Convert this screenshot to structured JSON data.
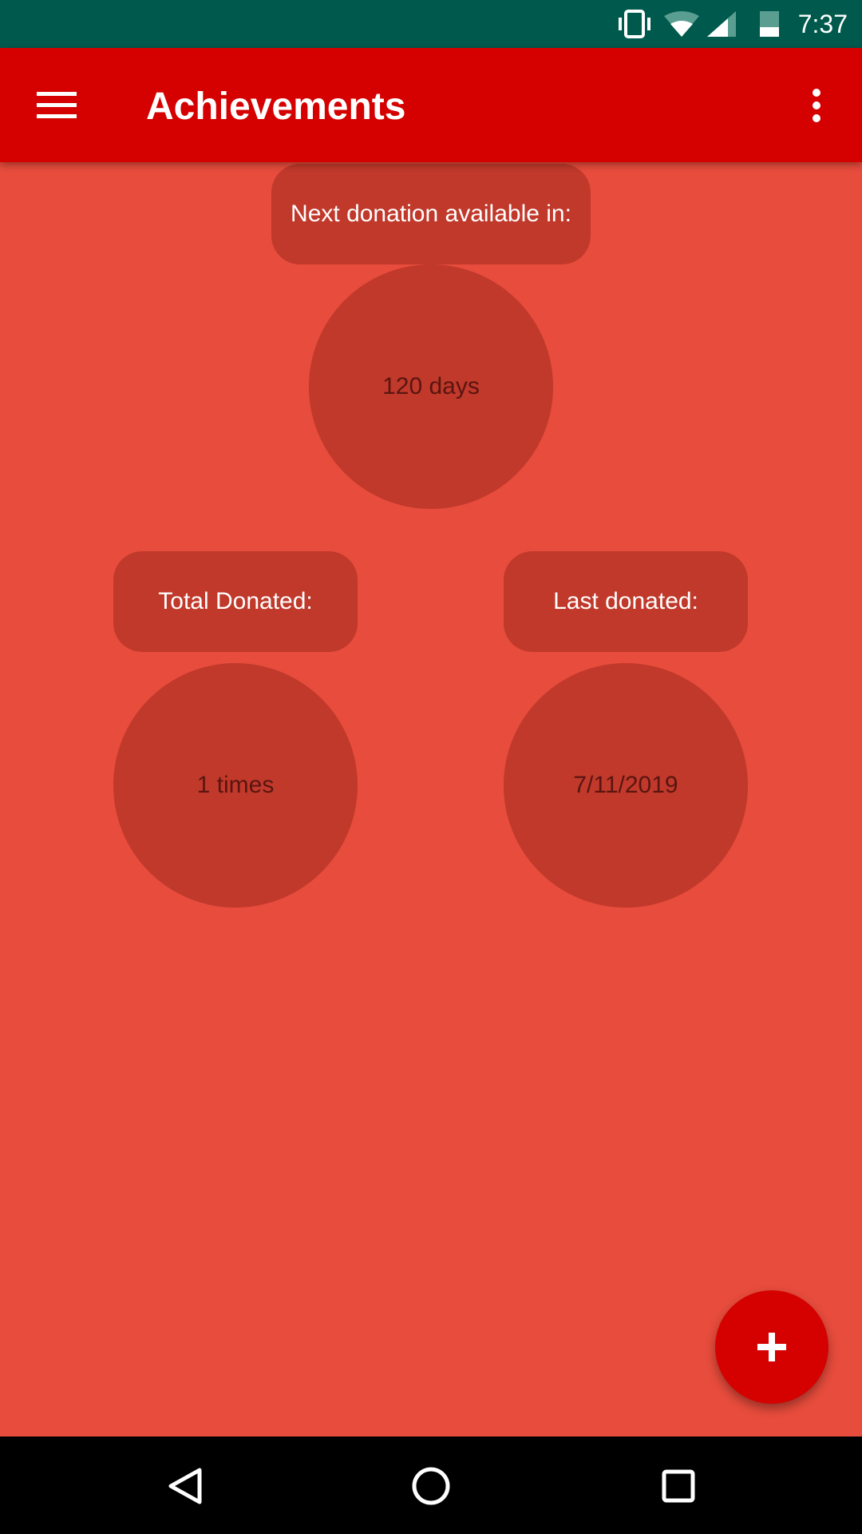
{
  "status_bar": {
    "time": "7:37",
    "icons": [
      "vibrate-icon",
      "wifi-icon",
      "signal-icon",
      "battery-icon"
    ]
  },
  "app_bar": {
    "title": "Achievements",
    "menu_icon": "hamburger-icon",
    "overflow_icon": "more-vert-icon"
  },
  "cards": {
    "next_donation": {
      "label": "Next donation available in:",
      "value": "120 days"
    },
    "total_donated": {
      "label": "Total Donated:",
      "value": "1 times"
    },
    "last_donated": {
      "label": "Last donated:",
      "value": "7/11/2019"
    }
  },
  "fab": {
    "icon": "plus-icon"
  },
  "colors": {
    "status_bar": "#00594D",
    "app_bar": "#D50000",
    "background": "#E74C3C",
    "card": "#C0392B"
  }
}
